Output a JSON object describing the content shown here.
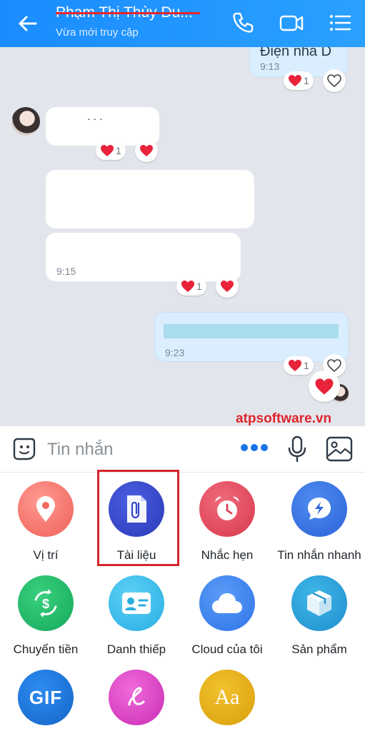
{
  "header": {
    "contact_name": "Phạm Thị Thùy Du...",
    "status": "Vừa mới truy cập"
  },
  "messages": {
    "m1_text": "Điện nha D",
    "m1_time": "9:13",
    "m1_react_count": "1",
    "m2_react_count": "1",
    "m3_time": "9:15",
    "m3_react_count": "1",
    "m4_time": "9:23",
    "m4_react_count": "1"
  },
  "input": {
    "placeholder": "Tin nhắn"
  },
  "watermark": "atpsoftware.vn",
  "actions": [
    {
      "label": "Vị trí",
      "icon": "location-pin-icon"
    },
    {
      "label": "Tài liệu",
      "icon": "paperclip-document-icon"
    },
    {
      "label": "Nhắc hẹn",
      "icon": "alarm-clock-icon"
    },
    {
      "label": "Tin nhắn nhanh",
      "icon": "quick-message-icon"
    },
    {
      "label": "Chuyển tiền",
      "icon": "money-transfer-icon"
    },
    {
      "label": "Danh thiếp",
      "icon": "business-card-icon"
    },
    {
      "label": "Cloud của tôi",
      "icon": "cloud-icon"
    },
    {
      "label": "Sản phẩm",
      "icon": "product-box-icon"
    },
    {
      "label": "",
      "icon": "gif-icon",
      "glyph": "GIF"
    },
    {
      "label": "",
      "icon": "handwriting-icon"
    },
    {
      "label": "",
      "icon": "font-style-icon",
      "glyph": "Aa"
    }
  ],
  "colors": {
    "header": "#1a8cff",
    "chat_bg": "#e2e6ec",
    "my_bubble": "#dbeeff",
    "heart": "#e8233a",
    "highlight": "#d7262c"
  }
}
